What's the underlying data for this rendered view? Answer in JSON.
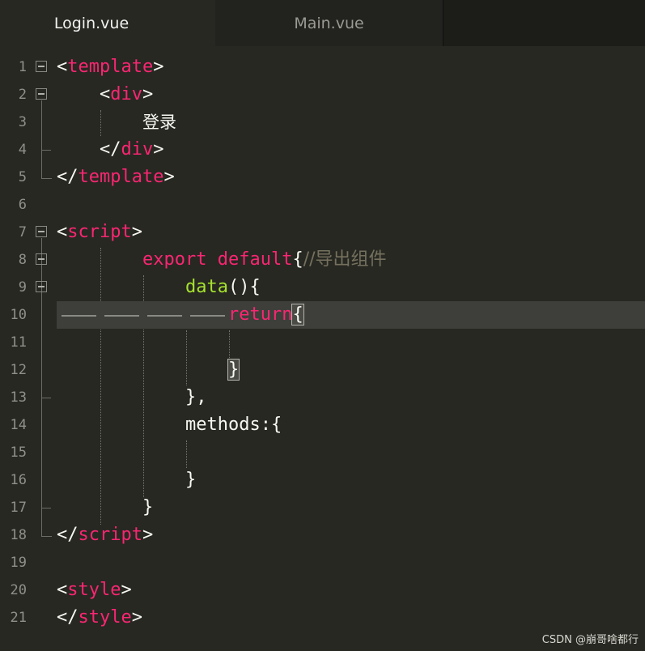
{
  "tabs": [
    {
      "label": "Login.vue",
      "active": true
    },
    {
      "label": "Main.vue",
      "active": false
    }
  ],
  "lines": {
    "l1": {
      "num": "1",
      "open": "<",
      "tag": "template",
      "close": ">"
    },
    "l2": {
      "num": "2",
      "open": "<",
      "tag": "div",
      "close": ">"
    },
    "l3": {
      "num": "3",
      "text": "登录"
    },
    "l4": {
      "num": "4",
      "open": "</",
      "tag": "div",
      "close": ">"
    },
    "l5": {
      "num": "5",
      "open": "</",
      "tag": "template",
      "close": ">"
    },
    "l6": {
      "num": "6"
    },
    "l7": {
      "num": "7",
      "open": "<",
      "tag": "script",
      "close": ">"
    },
    "l8": {
      "num": "8",
      "kw1": "export",
      "kw2": "default",
      "brace": "{",
      "comment": "//导出组件"
    },
    "l9": {
      "num": "9",
      "fn": "data",
      "rest": "(){"
    },
    "l10": {
      "num": "10",
      "kw": "return",
      "brace": "{"
    },
    "l11": {
      "num": "11"
    },
    "l12": {
      "num": "12",
      "brace": "}"
    },
    "l13": {
      "num": "13",
      "text": "},"
    },
    "l14": {
      "num": "14",
      "text": "methods:{"
    },
    "l15": {
      "num": "15"
    },
    "l16": {
      "num": "16",
      "text": "}"
    },
    "l17": {
      "num": "17",
      "text": "}"
    },
    "l18": {
      "num": "18",
      "open": "</",
      "tag": "script",
      "close": ">"
    },
    "l19": {
      "num": "19"
    },
    "l20": {
      "num": "20",
      "open": "<",
      "tag": "style",
      "close": ">"
    },
    "l21": {
      "num": "21",
      "open": "</",
      "tag": "style",
      "close": ">"
    }
  },
  "watermark": "CSDN @崩哥啥都行",
  "colors": {
    "background": "#272822",
    "tag": "#f92672",
    "function": "#a6e22e",
    "comment": "#75715e",
    "text": "#f8f8f2"
  }
}
